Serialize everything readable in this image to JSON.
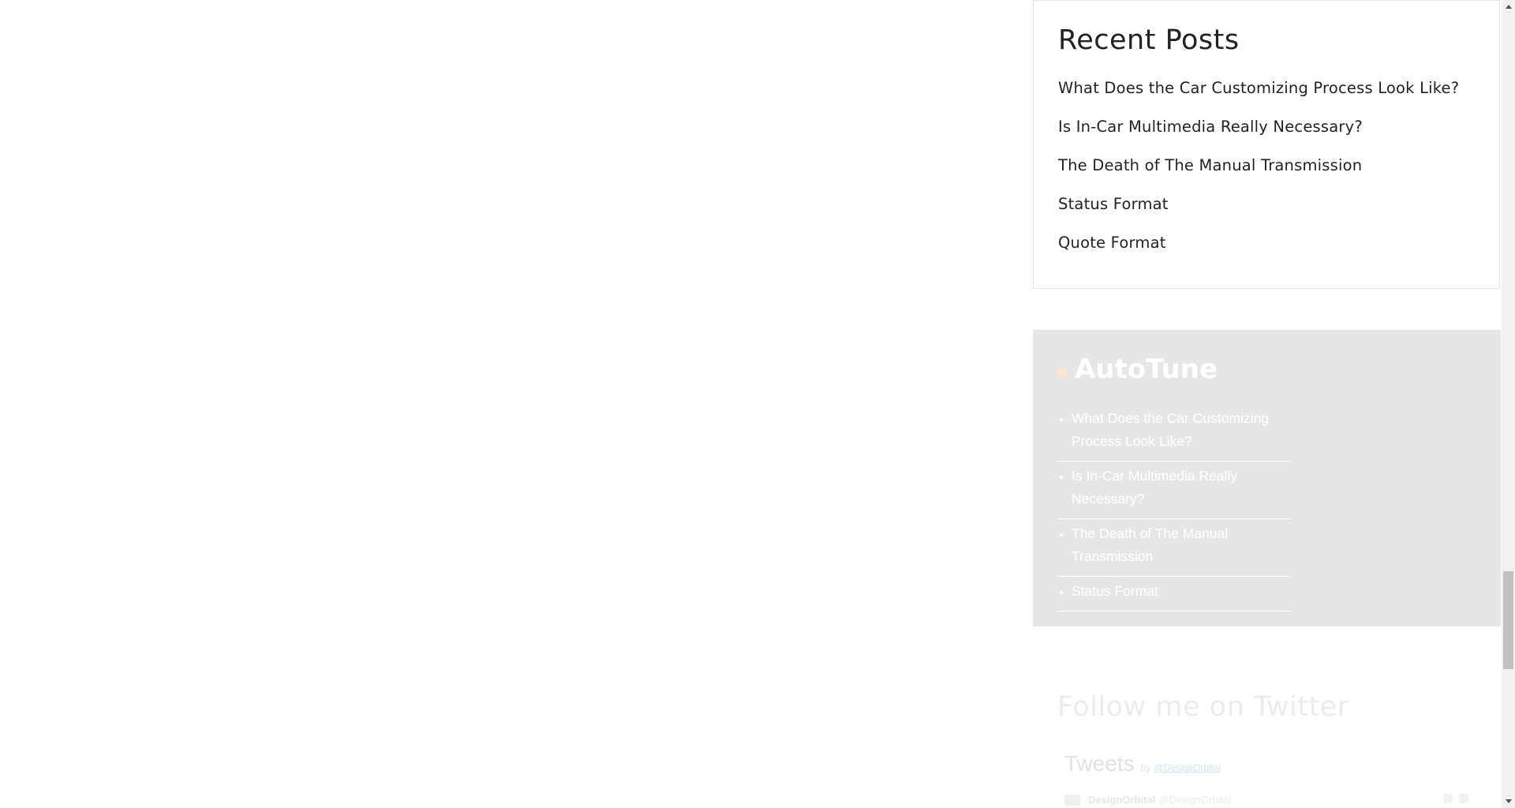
{
  "recent_posts": {
    "title": "Recent Posts",
    "items": [
      "What Does the Car Customizing Process Look Like?",
      "Is In-Car Multimedia Really Necessary?",
      "The Death of The Manual Transmission",
      "Status Format",
      "Quote Format"
    ]
  },
  "rss": {
    "title": "AutoTune",
    "icon": "rss-icon",
    "items": [
      "What Does the Car Customizing Process Look Like?",
      "Is In-Car Multimedia Really Necessary?",
      "The Death of The Manual Transmission",
      "Status Format"
    ]
  },
  "twitter": {
    "title": "Follow me on Twitter",
    "tweets_label": "Tweets",
    "by_label": "by",
    "handle": "@DesignOrbital",
    "tweet_author_name": "DesignOrbital",
    "tweet_author_handle": "@DesignOrbital"
  },
  "colors": {
    "rss_background": "#e6e6e6",
    "text_dark": "#222222",
    "border": "#e6e6e6"
  }
}
